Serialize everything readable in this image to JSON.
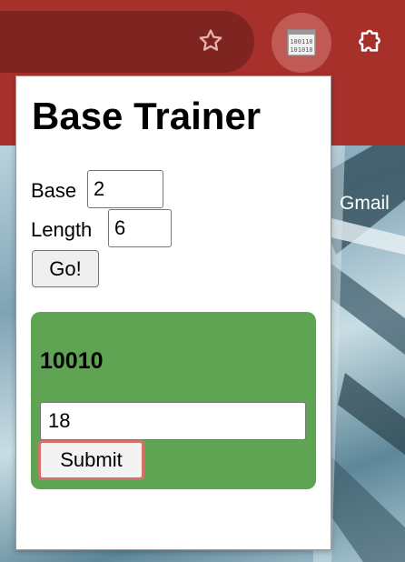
{
  "browser": {
    "bookmark_icon": "star-icon",
    "extension_icon": "binary-code-icon",
    "extensions_menu_icon": "puzzle-icon"
  },
  "background_page": {
    "gmail_link": "Gmail"
  },
  "popup": {
    "title": "Base Trainer",
    "base_label": "Base",
    "base_value": "2",
    "length_label": "Length",
    "length_value": "6",
    "go_label": "Go!",
    "challenge": "10010",
    "answer_value": "18",
    "submit_label": "Submit",
    "card_color": "#5fa452"
  }
}
